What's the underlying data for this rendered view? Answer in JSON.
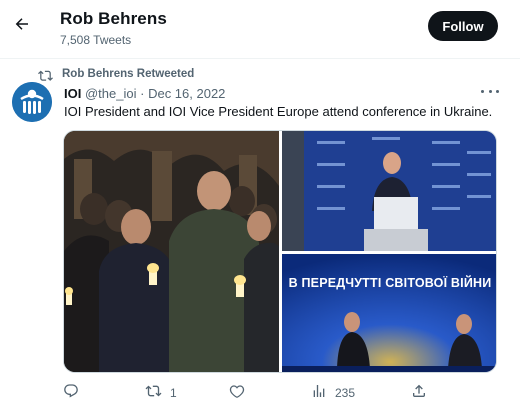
{
  "header": {
    "name": "Rob Behrens",
    "tweet_count": "7,508 Tweets",
    "follow_label": "Follow"
  },
  "retweet": {
    "label": "Rob Behrens Retweeted"
  },
  "tweet": {
    "name": "IOI",
    "handle": "@the_ioi",
    "separator": "·",
    "date": "Dec 16, 2022",
    "text": "IOI President and IOI Vice President Europe attend conference in Ukraine.",
    "media": {
      "banner_text": "В ПЕРЕДЧУТТІ СВІТОВОЇ ВІЙНИ"
    }
  },
  "actions": {
    "reply_count": "",
    "retweet_count": "1",
    "like_count": "",
    "views_count": "235"
  },
  "colors": {
    "text_primary": "#0f1419",
    "text_secondary": "#536471",
    "follow_bg": "#0f1419",
    "ioi_blue": "#1d6fb2",
    "conference_blue": "#1f3f92"
  }
}
